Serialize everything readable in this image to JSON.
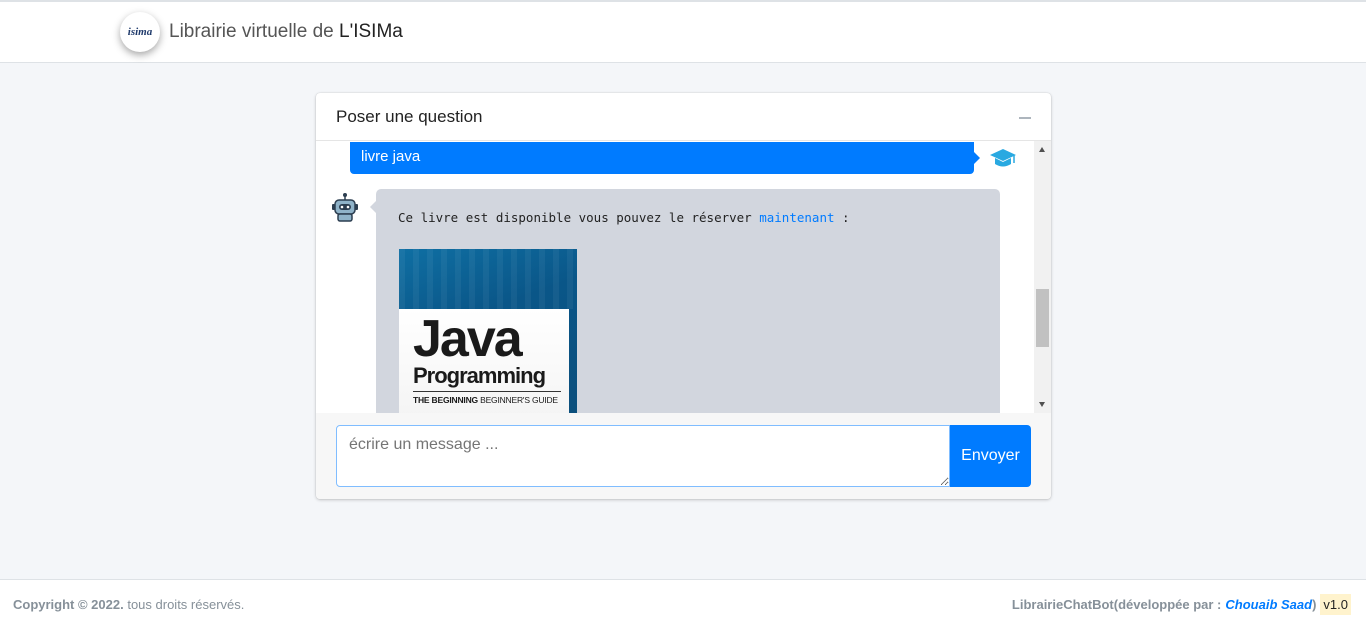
{
  "navbar": {
    "logo_text": "isima",
    "brand_prefix": "Librairie virtuelle de ",
    "brand_name": "L'ISIMa"
  },
  "chat": {
    "title": "Poser une question",
    "user_message": "livre java",
    "bot_message_before": "Ce livre est disponible vous pouvez le réserver ",
    "bot_message_link": "maintenant",
    "bot_message_after": " :",
    "book": {
      "title": "Java",
      "subtitle": "Programming",
      "tagline_bold": "THE BEGINNING",
      "tagline_rest": " BEGINNER'S GUIDE"
    },
    "input_placeholder": "écrire un message ...",
    "send_label": "Envoyer"
  },
  "footer": {
    "copyright_bold": "Copyright © 2022.",
    "copyright_rest": " tous droits réservés.",
    "app_name": "LibrairieChatBot",
    "dev_prefix": " (développée par :",
    "author": "Chouaib Saad",
    "dev_suffix": " )",
    "version": "v1.0"
  },
  "colors": {
    "primary": "#007bff",
    "bot_bubble": "#d2d6de"
  }
}
